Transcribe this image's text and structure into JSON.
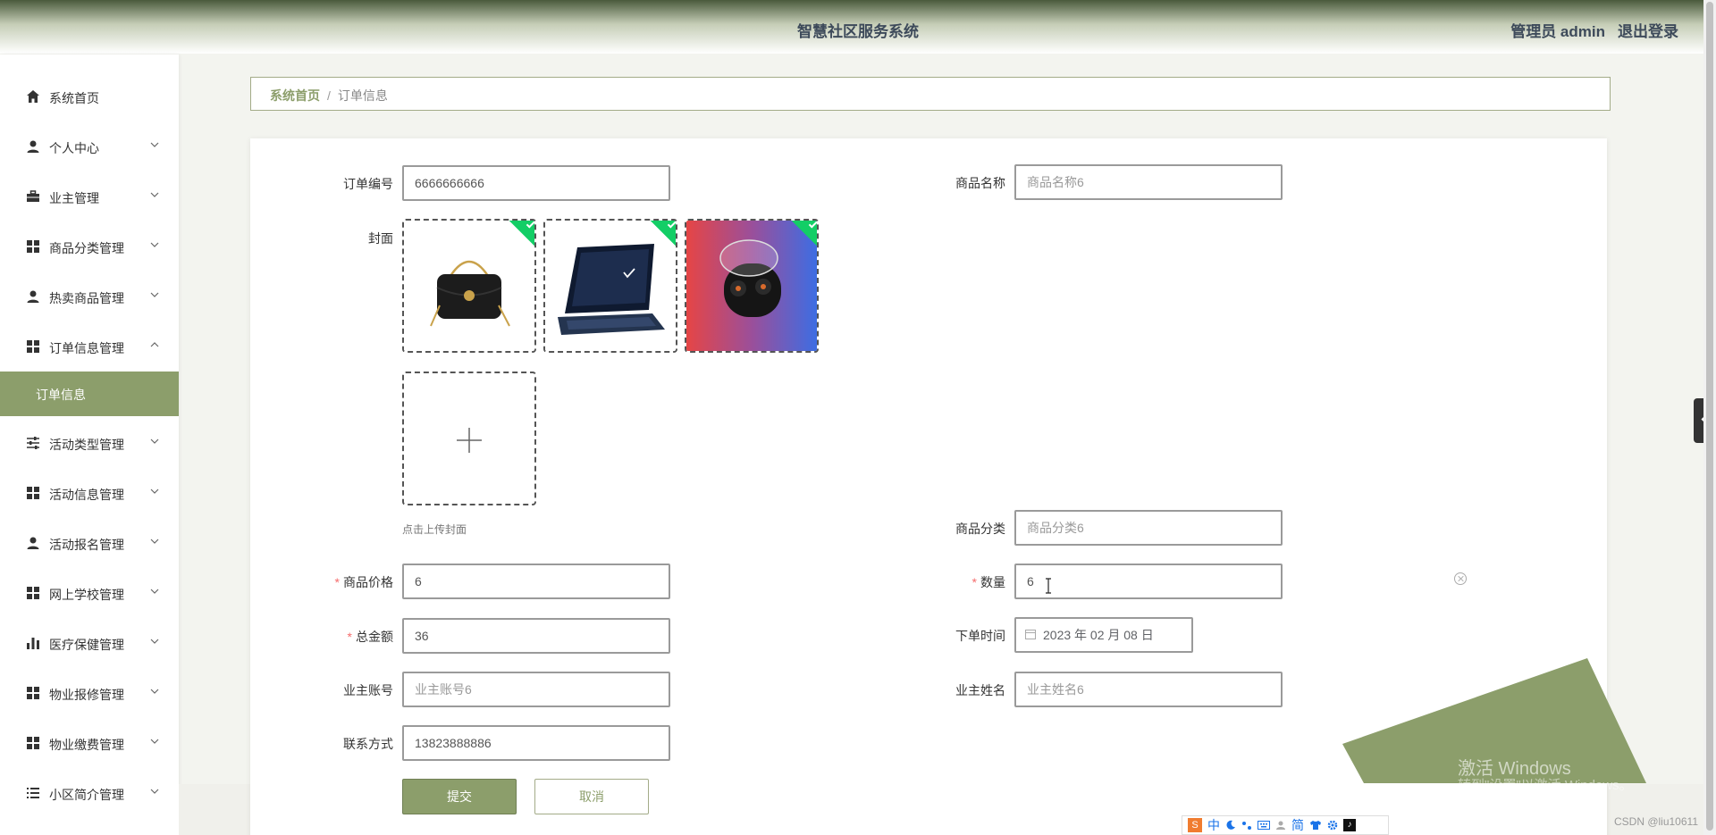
{
  "header": {
    "title": "智慧社区服务系统",
    "user_label": "管理员 admin",
    "logout": "退出登录"
  },
  "sidebar": {
    "items": [
      {
        "label": "系统首页",
        "icon": "home-icon"
      },
      {
        "label": "个人中心",
        "icon": "person-icon"
      },
      {
        "label": "业主管理",
        "icon": "briefcase-icon"
      },
      {
        "label": "商品分类管理",
        "icon": "grid-icon"
      },
      {
        "label": "热卖商品管理",
        "icon": "person-icon"
      },
      {
        "label": "订单信息管理",
        "icon": "grid-icon"
      },
      {
        "label": "活动类型管理",
        "icon": "sliders-icon"
      },
      {
        "label": "活动信息管理",
        "icon": "grid-icon"
      },
      {
        "label": "活动报名管理",
        "icon": "person-icon"
      },
      {
        "label": "网上学校管理",
        "icon": "grid-icon"
      },
      {
        "label": "医疗保健管理",
        "icon": "bar-chart-icon"
      },
      {
        "label": "物业报修管理",
        "icon": "grid-icon"
      },
      {
        "label": "物业缴费管理",
        "icon": "grid-icon"
      },
      {
        "label": "小区简介管理",
        "icon": "list-icon"
      }
    ],
    "active_sub": "订单信息"
  },
  "breadcrumb": {
    "home": "系统首页",
    "separator": "/",
    "current": "订单信息"
  },
  "form": {
    "order_no": {
      "label": "订单编号",
      "value": "6666666666"
    },
    "product_name": {
      "label": "商品名称",
      "placeholder": "商品名称6"
    },
    "cover": {
      "label": "封面",
      "hint": "点击上传封面"
    },
    "category": {
      "label": "商品分类",
      "placeholder": "商品分类6"
    },
    "price": {
      "label": "商品价格",
      "value": "6"
    },
    "quantity": {
      "label": "数量",
      "value": "6"
    },
    "total": {
      "label": "总金额",
      "value": "36"
    },
    "order_time": {
      "label": "下单时间",
      "value": "2023 年 02 月 08 日"
    },
    "owner_account": {
      "label": "业主账号",
      "placeholder": "业主账号6"
    },
    "owner_name": {
      "label": "业主姓名",
      "placeholder": "业主姓名6"
    },
    "contact": {
      "label": "联系方式",
      "value": "13823888886"
    },
    "submit": "提交",
    "cancel": "取消"
  },
  "overlay": {
    "activate": "激活 Windows",
    "activate_sub": "转到\"设置\"以激活 Windows。",
    "csdn": "CSDN @liu10611"
  },
  "ime": {
    "items": [
      "中",
      "简"
    ]
  },
  "colors": {
    "accent": "#8c9e6b",
    "success": "#13ce66",
    "required": "#f56c6c"
  }
}
